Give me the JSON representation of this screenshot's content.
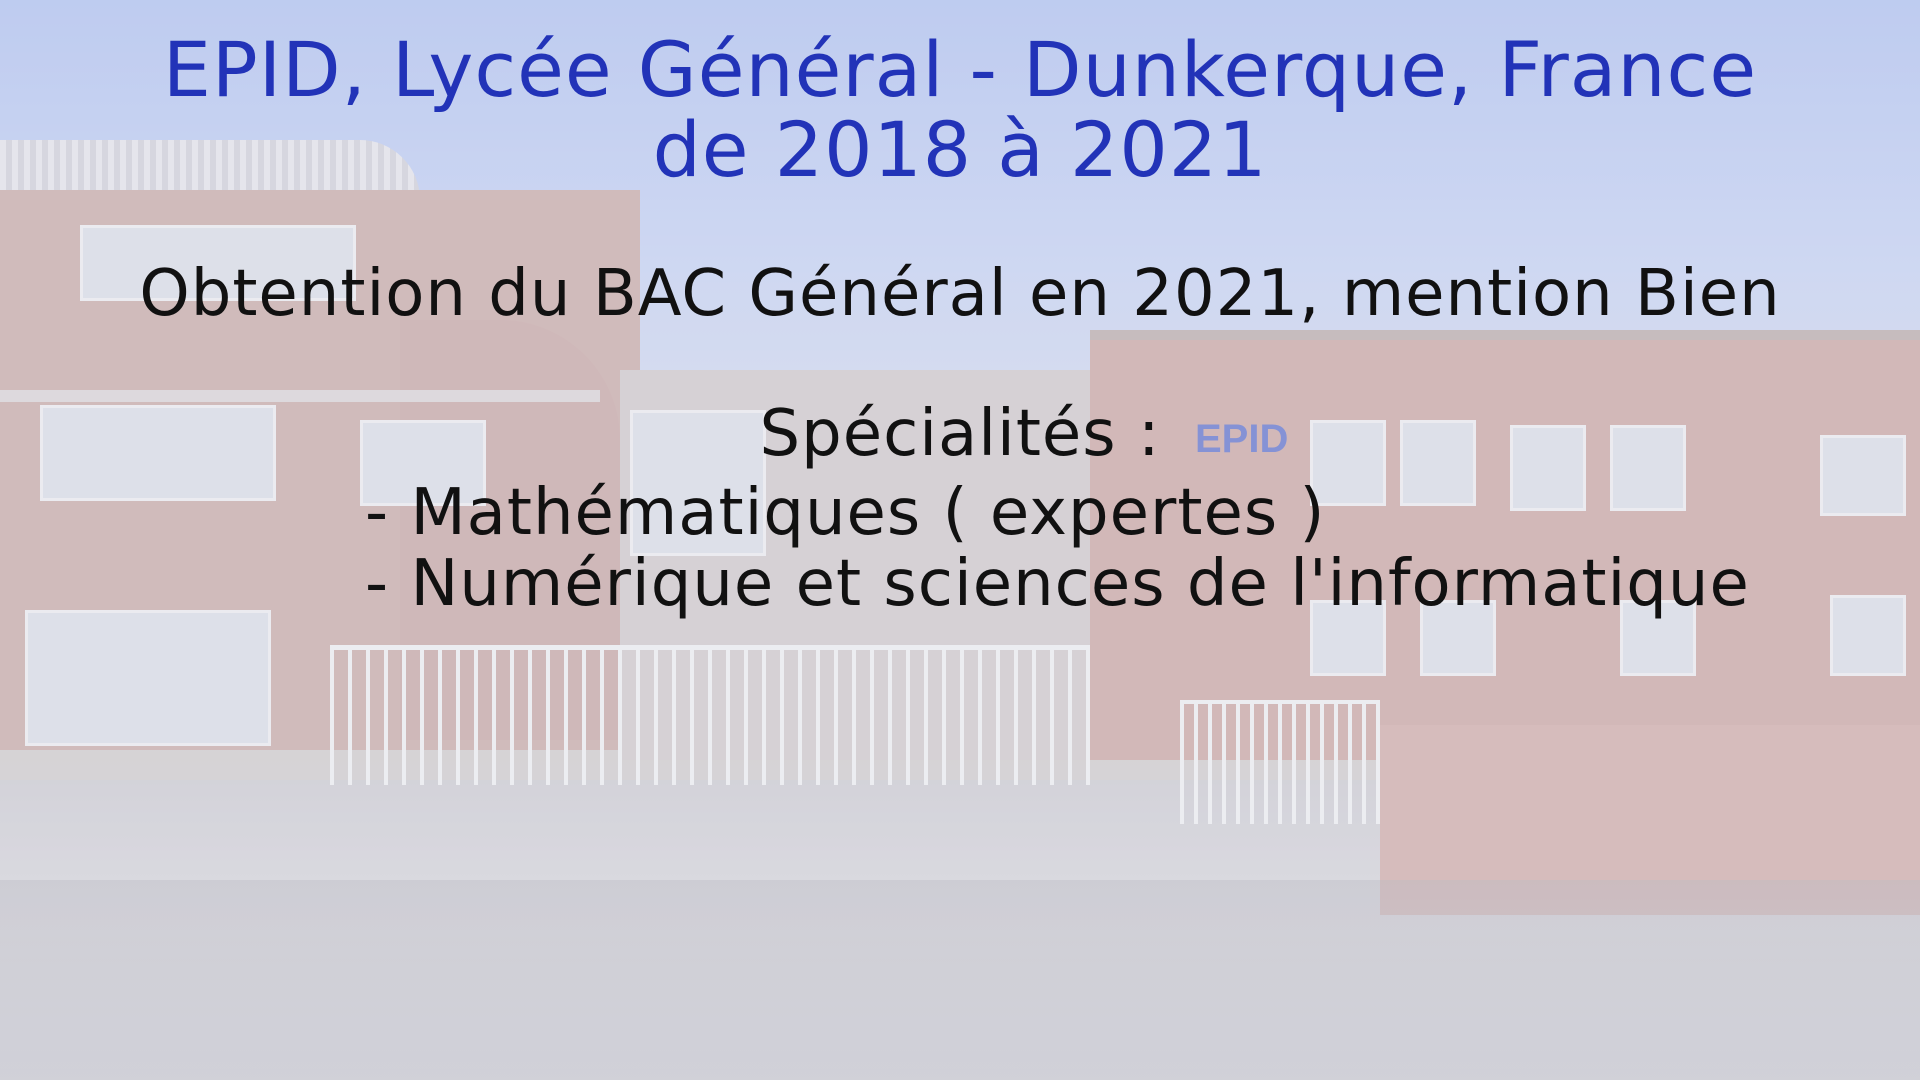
{
  "slide": {
    "title_line1": "EPID, Lycée Général - Dunkerque, France",
    "title_line2": "de 2018 à 2021",
    "diploma": "Obtention du BAC Général en 2021, mention Bien",
    "specialties_heading": "Spécialités :",
    "specialties": [
      "- Mathématiques ( expertes )",
      "- Numérique et sciences de l'informatique"
    ],
    "building_sign": "EPID"
  },
  "colors": {
    "title": "#2233b8",
    "body_text": "#111111"
  }
}
